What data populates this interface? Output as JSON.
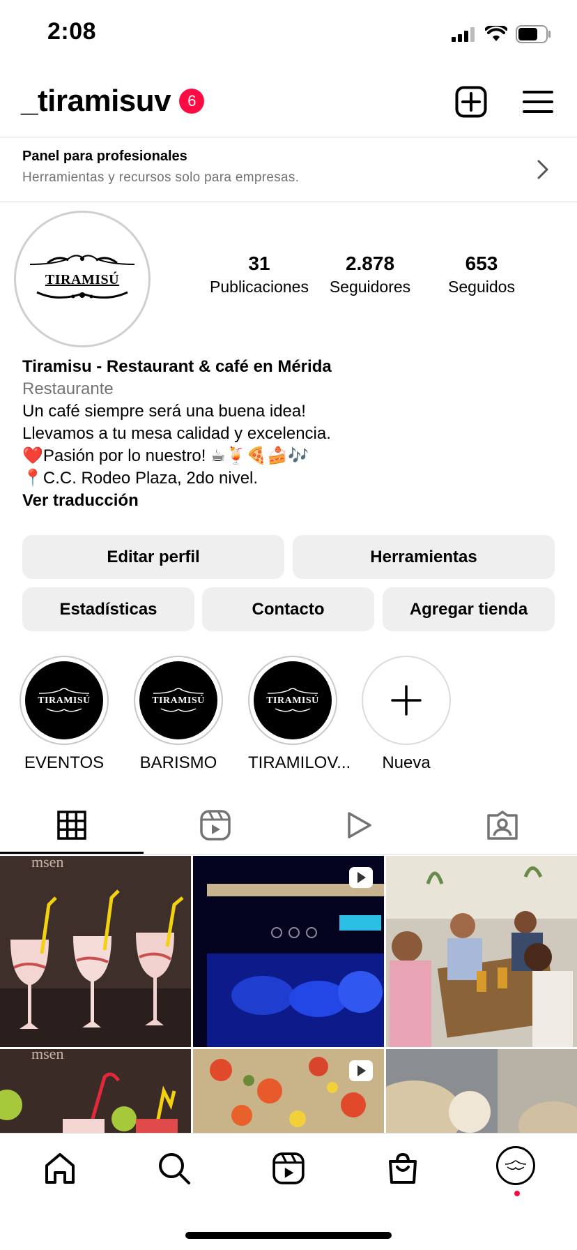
{
  "status_bar": {
    "time": "2:08"
  },
  "header": {
    "username": "_tiramisuv",
    "notification_count": "6"
  },
  "pro_panel": {
    "title": "Panel para profesionales",
    "subtitle": "Herramientas y recursos solo para empresas."
  },
  "profile": {
    "avatar_logo_text": "TIRAMISÚ",
    "stats": [
      {
        "value": "31",
        "label": "Publicaciones"
      },
      {
        "value": "2.878",
        "label": "Seguidores"
      },
      {
        "value": "653",
        "label": "Seguidos"
      }
    ],
    "bio": {
      "name": "Tiramisu - Restaurant & café en Mérida",
      "category": "Restaurante",
      "line1": "Un café siempre será una buena idea!",
      "line2": "Llevamos a tu mesa calidad y excelencia.",
      "line3": "❤️Pasión por lo nuestro! ☕🍹🍕🍰🎶",
      "line4": "📍C.C. Rodeo Plaza, 2do nivel.",
      "translate": "Ver traducción"
    }
  },
  "buttons": {
    "edit_profile": "Editar perfil",
    "tools": "Herramientas",
    "insights": "Estadísticas",
    "contact": "Contacto",
    "add_shop": "Agregar tienda"
  },
  "highlights": [
    {
      "name": "EVENTOS",
      "logo": "TIRAMISÚ"
    },
    {
      "name": "BARISMO",
      "logo": "TIRAMISÚ"
    },
    {
      "name": "TIRAMILOV...",
      "logo": "TIRAMISÚ"
    },
    {
      "name": "Nueva"
    }
  ],
  "tabs": [
    "grid-icon",
    "reels-icon",
    "video-play-icon",
    "tagged-icon"
  ],
  "colors": {
    "badge": "#ff0b44",
    "button_bg": "#efefef",
    "secondary_text": "#737373"
  }
}
